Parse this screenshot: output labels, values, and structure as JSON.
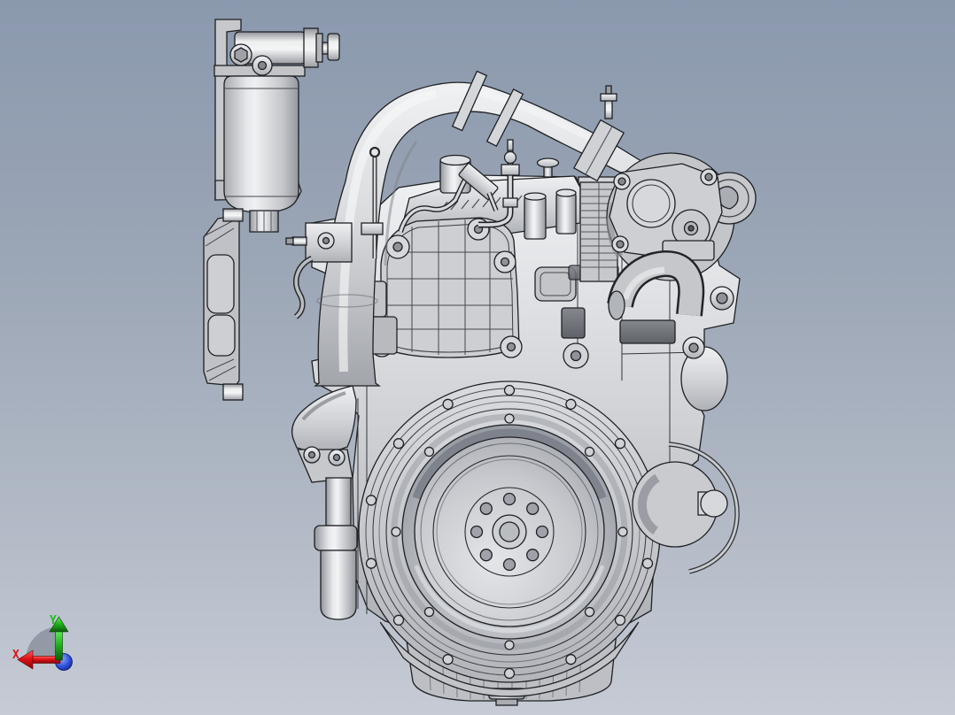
{
  "background": {
    "top": "#8b99ae",
    "bottom": "#c6cbd5"
  },
  "triad": {
    "x_label": "X",
    "y_label": "Y",
    "x_color": "#e11218",
    "y_color": "#1dbf1d",
    "z_color": "#1f3bd0",
    "fan_color": "#8e95a1"
  },
  "model": {
    "edge_color": "#1e2023",
    "body_light": "#e9eaec",
    "body_mid": "#c7c9cd",
    "body_dark": "#9a9da3",
    "parts": [
      "fuel-filter-assembly",
      "filter-mounting-bracket",
      "filter-inlet-fitting",
      "side-cover-plate",
      "intake-elbow-pipe",
      "hose-clamp",
      "pipe-coupler",
      "turbocharger",
      "turbo-flange-plate",
      "wastegate-actuator",
      "exhaust-downpipe",
      "cylinder-head",
      "exhaust-manifold-fins",
      "timing-gear-cover",
      "fuel-line",
      "injection-pump",
      "engine-block",
      "water-outlet-cone",
      "oil-filter-cylinder",
      "flywheel-housing",
      "flywheel",
      "starter-motor",
      "starter-cable",
      "oil-pan",
      "drain-plug",
      "orientation-triad"
    ]
  }
}
